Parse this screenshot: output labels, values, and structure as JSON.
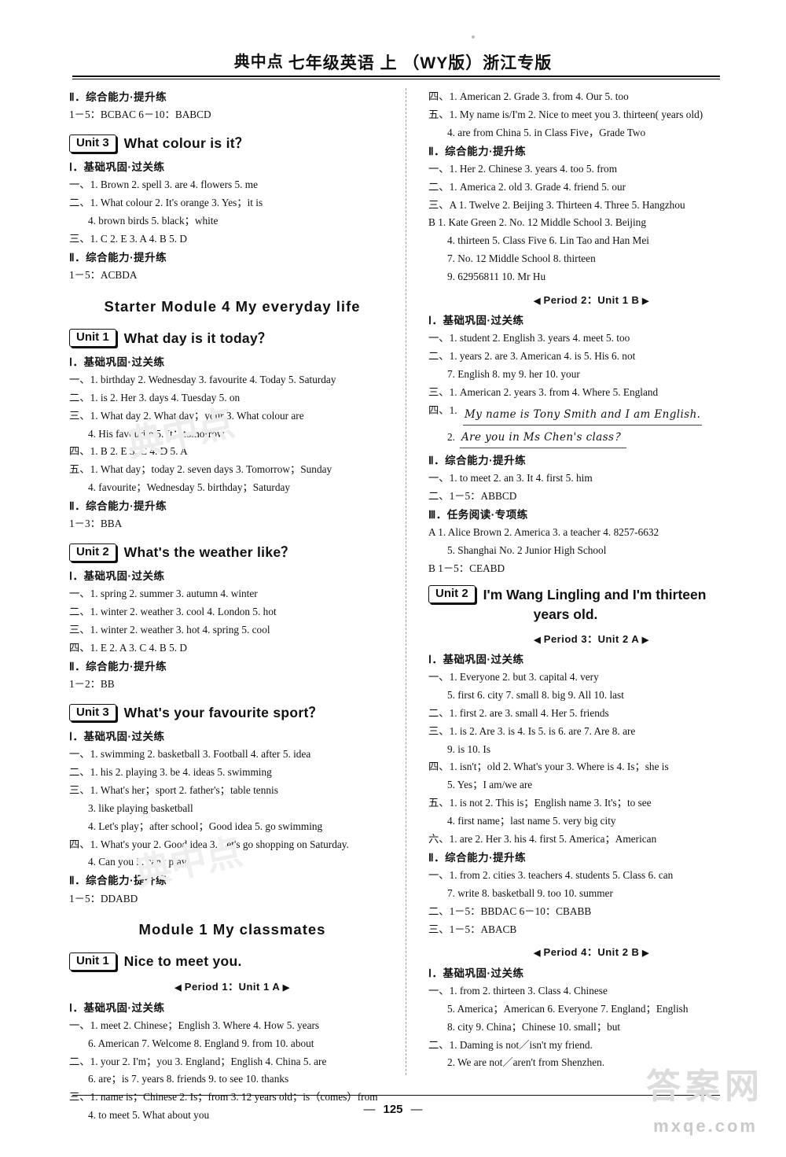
{
  "header": {
    "logo": "典中点",
    "title": "七年级英语  上  （WY版）浙江专版"
  },
  "footer": {
    "page": "125",
    "dash_left": "—",
    "dash_right": "—"
  },
  "watermarks": {
    "brand_cn": "答案网",
    "site": "mxqe.com",
    "mid1": "典中点",
    "mid2": "典中点"
  },
  "labels": {
    "sec1": "Ⅰ．基础巩固·过关练",
    "sec2": "Ⅱ．综合能力·提升练",
    "sec3": "Ⅲ．任务阅读·专项练"
  },
  "left": [
    {
      "type": "sec",
      "text": "Ⅱ．综合能力·提升练"
    },
    {
      "type": "line",
      "text": "1－5：BCBAC   6－10：BABCD"
    },
    {
      "type": "unit",
      "badge": "Unit 3",
      "title": "What colour is it？"
    },
    {
      "type": "sec",
      "text": "Ⅰ．基础巩固·过关练"
    },
    {
      "type": "line",
      "text": "一、1. Brown   2. spell   3. are   4. flowers   5. me"
    },
    {
      "type": "line",
      "text": "二、1. What colour   2. It's orange   3. Yes；it is"
    },
    {
      "type": "indent",
      "text": "4. brown birds   5. black；white"
    },
    {
      "type": "line",
      "text": "三、1. C   2. E   3. A   4. B   5. D"
    },
    {
      "type": "sec",
      "text": "Ⅱ．综合能力·提升练"
    },
    {
      "type": "line",
      "text": "1－5：ACBDA"
    },
    {
      "type": "module",
      "text": "Starter Module 4   My everyday life"
    },
    {
      "type": "unit",
      "badge": "Unit 1",
      "title": "What day is it today？"
    },
    {
      "type": "sec",
      "text": "Ⅰ．基础巩固·过关练"
    },
    {
      "type": "line",
      "text": "一、1. birthday   2. Wednesday   3. favourite   4. Today   5. Saturday"
    },
    {
      "type": "line",
      "text": "二、1. is   2. Her   3. days   4. Tuesday   5. on"
    },
    {
      "type": "line",
      "text": "三、1. What day   2. What day；your   3. What colour are"
    },
    {
      "type": "indent",
      "text": "4. His favourite   5. It；tomorrow"
    },
    {
      "type": "line",
      "text": "四、1. B   2. E   3. C   4. D   5. A"
    },
    {
      "type": "line",
      "text": "五、1. What day；today   2. seven days   3. Tomorrow；Sunday"
    },
    {
      "type": "indent",
      "text": "4. favourite；Wednesday   5. birthday；Saturday"
    },
    {
      "type": "sec",
      "text": "Ⅱ．综合能力·提升练"
    },
    {
      "type": "line",
      "text": "1－3：BBA"
    },
    {
      "type": "unit",
      "badge": "Unit 2",
      "title": "What's the weather like？"
    },
    {
      "type": "sec",
      "text": "Ⅰ．基础巩固·过关练"
    },
    {
      "type": "line",
      "text": "一、1. spring   2. summer   3. autumn   4. winter"
    },
    {
      "type": "line",
      "text": "二、1. winter   2. weather   3. cool   4. London   5. hot"
    },
    {
      "type": "line",
      "text": "三、1. winter   2. weather   3. hot   4. spring   5. cool"
    },
    {
      "type": "line",
      "text": "四、1. E   2. A   3. C   4. B   5. D"
    },
    {
      "type": "sec",
      "text": "Ⅱ．综合能力·提升练"
    },
    {
      "type": "line",
      "text": "1－2：BB"
    },
    {
      "type": "unit",
      "badge": "Unit 3",
      "title": "What's your favourite sport？"
    },
    {
      "type": "sec",
      "text": "Ⅰ．基础巩固·过关练"
    },
    {
      "type": "line",
      "text": "一、1. swimming   2. basketball   3. Football   4. after   5. idea"
    },
    {
      "type": "line",
      "text": "二、1. his   2. playing   3. be   4. ideas   5. swimming"
    },
    {
      "type": "line",
      "text": "三、1. What's her；sport   2. father's；table tennis"
    },
    {
      "type": "indent",
      "text": "3. like playing basketball"
    },
    {
      "type": "indent",
      "text": "4. Let's play；after school；Good idea   5. go swimming"
    },
    {
      "type": "line",
      "text": "四、1. What's your   2. Good idea   3. Let's go shopping on Saturday."
    },
    {
      "type": "indent",
      "text": "4. Can you   5. can't play"
    },
    {
      "type": "sec",
      "text": "Ⅱ．综合能力·提升练"
    },
    {
      "type": "line",
      "text": "1－5：DDABD"
    },
    {
      "type": "module",
      "text": "Module 1   My classmates"
    },
    {
      "type": "unit",
      "badge": "Unit 1",
      "title": "Nice to meet you."
    },
    {
      "type": "period",
      "text": "Period 1：Unit 1 A"
    },
    {
      "type": "sec",
      "text": "Ⅰ．基础巩固·过关练"
    },
    {
      "type": "line",
      "text": "一、1. meet   2. Chinese；English   3. Where   4. How   5. years"
    },
    {
      "type": "indent",
      "text": "6. American   7. Welcome   8. England   9. from   10. about"
    },
    {
      "type": "line",
      "text": "二、1. your   2. I'm；you   3. England；English   4. China   5. are"
    },
    {
      "type": "indent",
      "text": "6. are；is   7. years   8. friends   9. to see   10. thanks"
    },
    {
      "type": "line",
      "text": "三、1. name is；Chinese   2. Is；from   3. 12 years old；is（comes）from"
    },
    {
      "type": "indent",
      "text": "4. to meet   5. What about you"
    }
  ],
  "right": [
    {
      "type": "line",
      "text": "四、1. American   2. Grade   3. from   4. Our   5. too"
    },
    {
      "type": "line",
      "text": "五、1. My name is/I'm   2. Nice to meet you   3. thirteen( years old)"
    },
    {
      "type": "indent",
      "text": "4. are from China   5. in Class Five，Grade Two"
    },
    {
      "type": "sec",
      "text": "Ⅱ．综合能力·提升练"
    },
    {
      "type": "line",
      "text": "一、1. Her   2. Chinese   3. years   4. too   5. from"
    },
    {
      "type": "line",
      "text": "二、1. America   2. old   3. Grade   4. friend   5. our"
    },
    {
      "type": "line",
      "text": "三、A   1. Twelve   2. Beijing   3. Thirteen   4. Three   5. Hangzhou"
    },
    {
      "type": "line",
      "text": "B   1. Kate Green   2. No. 12 Middle School   3. Beijing"
    },
    {
      "type": "indent",
      "text": "4. thirteen   5. Class Five   6. Lin Tao and Han Mei"
    },
    {
      "type": "indent",
      "text": "7. No. 12 Middle School   8. thirteen"
    },
    {
      "type": "indent",
      "text": "9. 62956811   10. Mr Hu"
    },
    {
      "type": "period",
      "text": "Period 2：Unit 1 B"
    },
    {
      "type": "sec",
      "text": "Ⅰ．基础巩固·过关练"
    },
    {
      "type": "line",
      "text": "一、1. student   2. English   3. years   4. meet   5. too"
    },
    {
      "type": "line",
      "text": "二、1. years   2. are   3. American   4. is   5. His   6. not"
    },
    {
      "type": "indent",
      "text": "7. English   8. my   9. her   10. your"
    },
    {
      "type": "line",
      "text": "三、1. American   2. years   3. from   4. Where   5. England"
    },
    {
      "type": "hand-lead",
      "text": "四、1."
    },
    {
      "type": "hand",
      "text": "My name is Tony Smith and I am English."
    },
    {
      "type": "hand2",
      "num": "2.",
      "text": "Are you in Ms Chen's class？"
    },
    {
      "type": "sec",
      "text": "Ⅱ．综合能力·提升练"
    },
    {
      "type": "line",
      "text": "一、1. to meet   2. an   3. It   4. first   5. him"
    },
    {
      "type": "line",
      "text": "二、1－5：ABBCD"
    },
    {
      "type": "sec",
      "text": "Ⅲ．任务阅读·专项练"
    },
    {
      "type": "line",
      "text": "A   1. Alice Brown   2. America   3. a teacher   4. 8257-6632"
    },
    {
      "type": "indent",
      "text": "5. Shanghai No. 2 Junior High School"
    },
    {
      "type": "line",
      "text": "B   1－5：CEABD"
    },
    {
      "type": "bigunit",
      "badge": "Unit 2",
      "title": "I'm Wang Lingling and I'm thirteen",
      "cont": "years old."
    },
    {
      "type": "period",
      "text": "Period 3：Unit 2 A"
    },
    {
      "type": "sec",
      "text": "Ⅰ．基础巩固·过关练"
    },
    {
      "type": "line",
      "text": "一、1. Everyone   2. but   3. capital   4. very"
    },
    {
      "type": "indent",
      "text": "5. first   6. city   7. small   8. big   9. All   10. last"
    },
    {
      "type": "line",
      "text": "二、1. first   2. are   3. small   4. Her   5. friends"
    },
    {
      "type": "line",
      "text": "三、1. is   2. Are   3. is   4. Is   5. is   6. are   7. Are   8. are"
    },
    {
      "type": "indent",
      "text": "9. is   10. Is"
    },
    {
      "type": "line",
      "text": "四、1. isn't；old   2. What's your   3. Where is   4. Is；she is"
    },
    {
      "type": "indent",
      "text": "5. Yes；I am/we are"
    },
    {
      "type": "line",
      "text": "五、1. is not   2. This is；English name   3. It's；to see"
    },
    {
      "type": "indent",
      "text": "4. first name；last name   5. very big city"
    },
    {
      "type": "line",
      "text": "六、1. are   2. Her   3. his   4. first   5. America；American"
    },
    {
      "type": "sec",
      "text": "Ⅱ．综合能力·提升练"
    },
    {
      "type": "line",
      "text": "一、1. from   2. cities   3. teachers   4. students   5. Class   6. can"
    },
    {
      "type": "indent",
      "text": "7. write   8. basketball   9. too   10. summer"
    },
    {
      "type": "line",
      "text": "二、1－5：BBDAC   6－10：CBABB"
    },
    {
      "type": "line",
      "text": "三、1－5：ABACB"
    },
    {
      "type": "period",
      "text": "Period 4：Unit 2 B"
    },
    {
      "type": "sec",
      "text": "Ⅰ．基础巩固·过关练"
    },
    {
      "type": "line",
      "text": "一、1. from   2. thirteen   3. Class   4. Chinese"
    },
    {
      "type": "indent",
      "text": "5. America；American   6. Everyone   7. England；English"
    },
    {
      "type": "indent",
      "text": "8. city   9. China；Chinese   10. small；but"
    },
    {
      "type": "line",
      "text": "二、1. Daming is not／isn't my friend."
    },
    {
      "type": "indent",
      "text": "2. We are not／aren't from Shenzhen."
    }
  ]
}
